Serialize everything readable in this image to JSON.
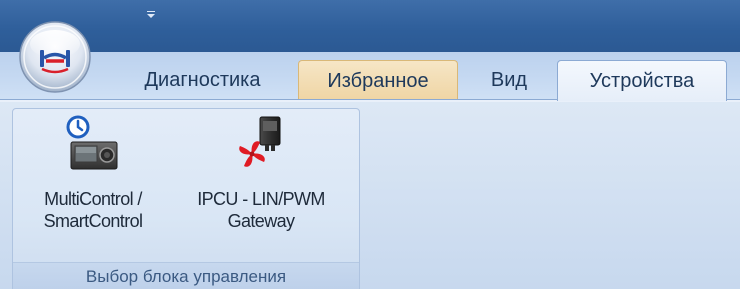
{
  "app": {
    "menu_button_icon": "app-logo-icon",
    "qat_icon": "customize-dropdown-icon"
  },
  "tabs": [
    {
      "label": "Диагностика",
      "state": "normal"
    },
    {
      "label": "Избранное",
      "state": "highlighted"
    },
    {
      "label": "Вид",
      "state": "normal"
    },
    {
      "label": "Устройства",
      "state": "selected"
    }
  ],
  "ribbon": {
    "group": {
      "label": "Выбор блока управления",
      "buttons": [
        {
          "line1": "MultiControl /",
          "line2": "SmartControl",
          "icon": "multicontrol-timer-icon"
        },
        {
          "line1": "IPCU - LIN/PWM",
          "line2": "Gateway",
          "icon": "ipcu-fan-gateway-icon"
        }
      ]
    }
  },
  "colors": {
    "titlebar": "#2f5f9b",
    "tab_text": "#1e395b",
    "highlight_tab": "#f2dcb2",
    "ribbon": "#d3e1f2",
    "fan_red": "#e01b24"
  }
}
